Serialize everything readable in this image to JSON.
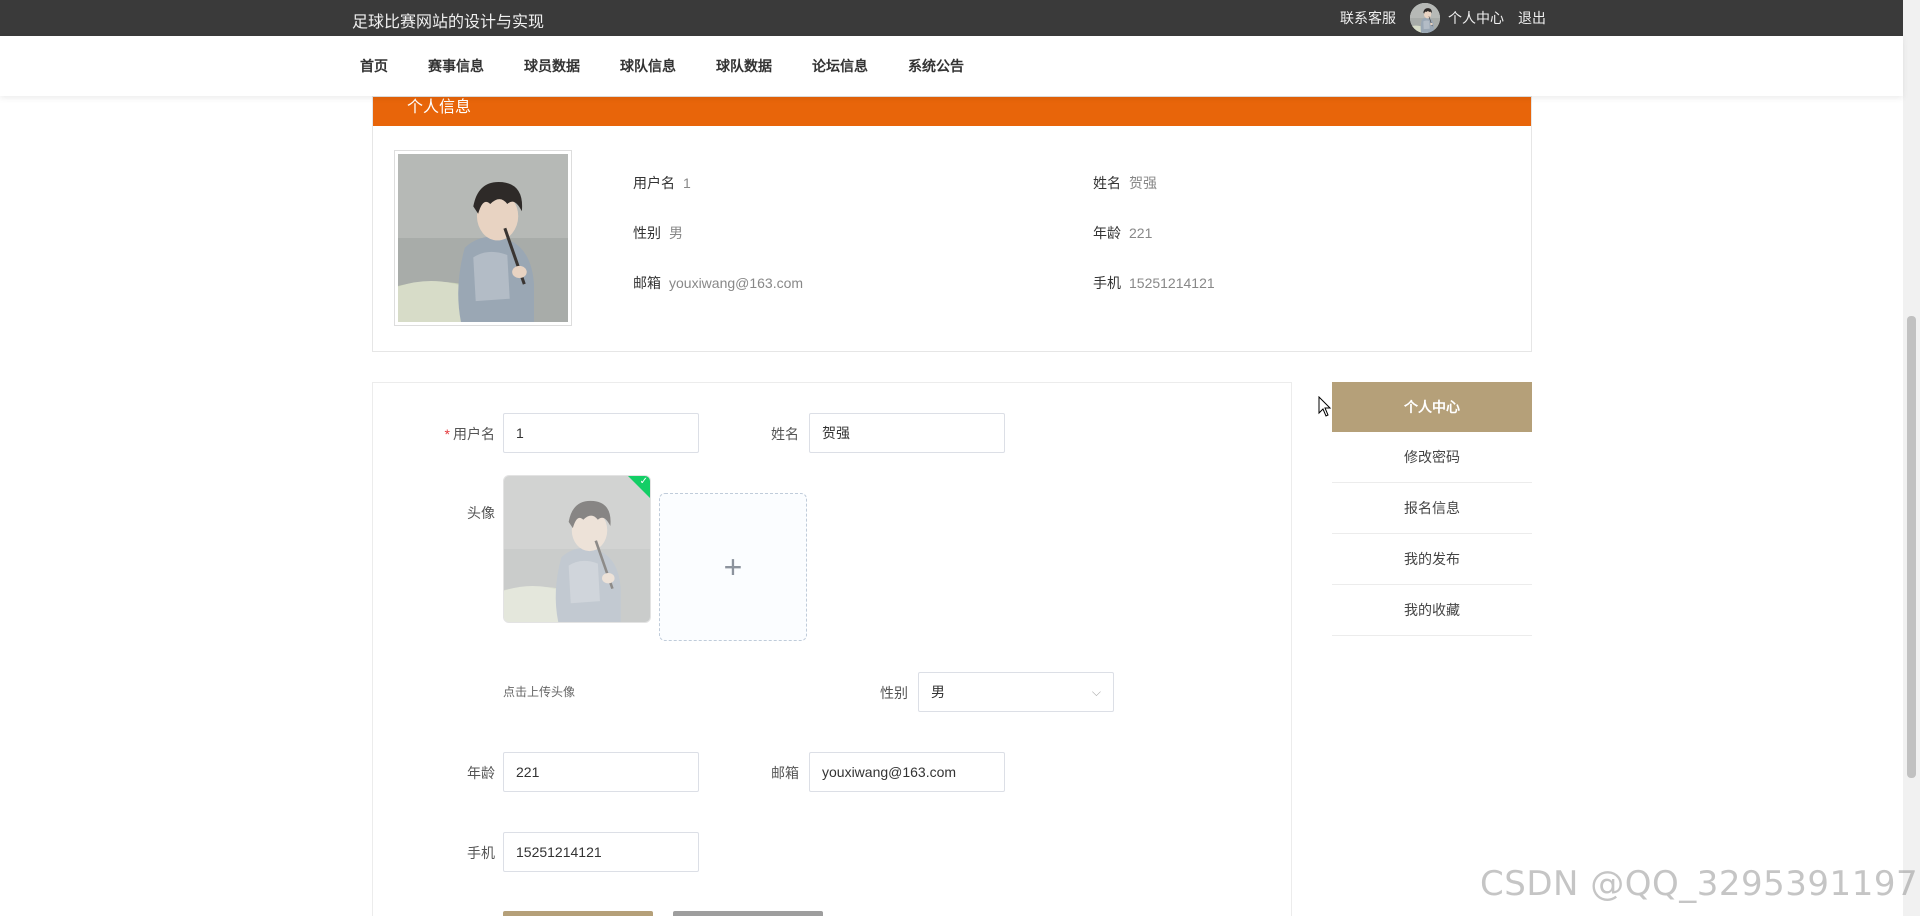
{
  "topbar": {
    "site_title": "足球比赛网站的设计与实现",
    "contact": "联系客服",
    "user_center": "个人中心",
    "logout": "退出"
  },
  "nav": {
    "items": [
      {
        "label": "首页"
      },
      {
        "label": "赛事信息"
      },
      {
        "label": "球员数据"
      },
      {
        "label": "球队信息"
      },
      {
        "label": "球队数据"
      },
      {
        "label": "论坛信息"
      },
      {
        "label": "系统公告"
      }
    ]
  },
  "info_card": {
    "title": "个人信息",
    "username_label": "用户名",
    "username_value": "1",
    "name_label": "姓名",
    "name_value": "贺强",
    "gender_label": "性别",
    "gender_value": "男",
    "age_label": "年龄",
    "age_value": "221",
    "email_label": "邮箱",
    "email_value": "youxiwang@163.com",
    "phone_label": "手机",
    "phone_value": "15251214121"
  },
  "form": {
    "required_mark": "*",
    "username_label": "用户名",
    "username_value": "1",
    "name_label": "姓名",
    "name_value": "贺强",
    "avatar_label": "头像",
    "upload_plus": "+",
    "upload_tip": "点击上传头像",
    "gender_label": "性别",
    "gender_value": "男",
    "age_label": "年龄",
    "age_value": "221",
    "email_label": "邮箱",
    "email_value": "youxiwang@163.com",
    "phone_label": "手机",
    "phone_value": "15251214121"
  },
  "sidemenu": {
    "active": "个人中心",
    "items": [
      {
        "label": "修改密码"
      },
      {
        "label": "报名信息"
      },
      {
        "label": "我的发布"
      },
      {
        "label": "我的收藏"
      }
    ]
  },
  "watermark": "CSDN @QQ_3295391197",
  "colors": {
    "topbar": "#3a3a3a",
    "info_header": "#e8650a",
    "accent": "#b5a079",
    "secondary_button": "#9e9e9e",
    "success": "#13ce66"
  },
  "icons": {
    "avatar": "avatar-icon",
    "plus": "plus-icon",
    "chevron": "chevron-down-icon",
    "check": "check-icon",
    "cursor": "cursor-icon"
  }
}
